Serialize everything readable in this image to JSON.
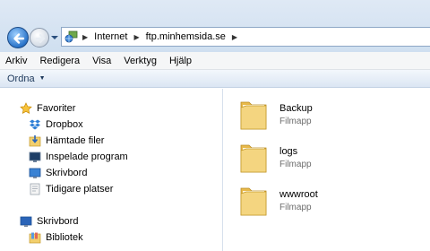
{
  "address": {
    "segments": [
      "Internet",
      "ftp.minhemsida.se"
    ]
  },
  "menu": [
    "Arkiv",
    "Redigera",
    "Visa",
    "Verktyg",
    "Hjälp"
  ],
  "toolbar": {
    "organize_label": "Ordna"
  },
  "nav": {
    "favorites": {
      "label": "Favoriter",
      "items": [
        "Dropbox",
        "Hämtade filer",
        "Inspelade program",
        "Skrivbord",
        "Tidigare platser"
      ]
    },
    "desktop": {
      "label": "Skrivbord",
      "items": [
        "Bibliotek"
      ]
    }
  },
  "folders": [
    {
      "name": "Backup",
      "type": "Filmapp"
    },
    {
      "name": "logs",
      "type": "Filmapp"
    },
    {
      "name": "wwwroot",
      "type": "Filmapp"
    }
  ],
  "colors": {
    "accent": "#2a74c9",
    "folder": "#f2cf6d",
    "star": "#f5b400"
  },
  "icons": [
    "back-arrow-icon",
    "forward-arrow-icon",
    "recent-pages-icon",
    "network-location-icon",
    "star-icon",
    "dropbox-icon",
    "downloads-icon",
    "recorded-tv-icon",
    "desktop-icon",
    "recent-places-icon",
    "libraries-icon",
    "folder-icon"
  ]
}
